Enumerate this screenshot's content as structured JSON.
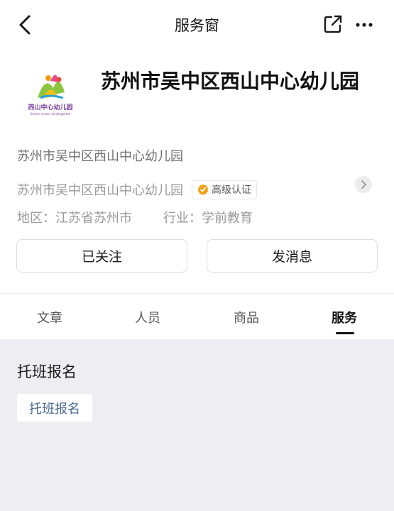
{
  "nav": {
    "title": "服务窗"
  },
  "org": {
    "name": "苏州市吴中区西山中心幼儿园",
    "logo_text_cn": "西山中心幼儿园",
    "logo_text_en": "Xishan center kindergarten",
    "subtitle": "苏州市吴中区西山中心幼儿园",
    "cert_name": "苏州市吴中区西山中心幼儿园",
    "cert_badge": "高级认证",
    "region": "地区：江苏省苏州市",
    "industry": "行业：学前教育"
  },
  "actions": {
    "follow": "已关注",
    "message": "发消息"
  },
  "tabs": [
    {
      "label": "文章"
    },
    {
      "label": "人员"
    },
    {
      "label": "商品"
    },
    {
      "label": "服务",
      "active": true
    }
  ],
  "service": {
    "section_title": "托班报名",
    "items": [
      {
        "label": "托班报名"
      }
    ]
  },
  "colors": {
    "badge_orange": "#f0a21c",
    "tag_text": "#4b6b92",
    "content_bg": "#eeeef2"
  },
  "icons": [
    "back-arrow-icon",
    "share-icon",
    "more-icon",
    "verified-badge-icon",
    "chevron-right-icon"
  ]
}
